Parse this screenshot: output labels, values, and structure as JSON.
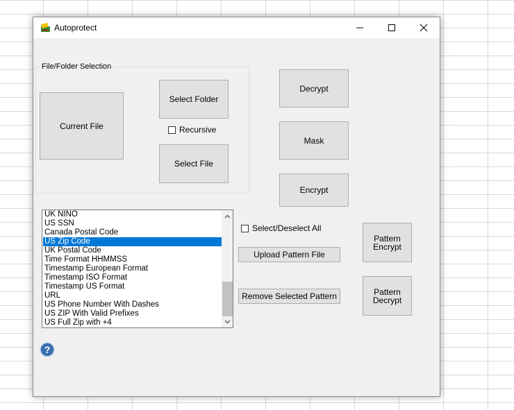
{
  "window": {
    "title": "Autoprotect"
  },
  "file_folder": {
    "group_label": "File/Folder Selection",
    "current_file": "Current File",
    "select_folder": "Select Folder",
    "recursive_label": "Recursive",
    "recursive_checked": false,
    "select_file": "Select File"
  },
  "actions": {
    "decrypt": "Decrypt",
    "mask": "Mask",
    "encrypt": "Encrypt"
  },
  "patterns": {
    "items": [
      "UK NINO",
      "US SSN",
      "Canada Postal Code",
      "US Zip Code",
      "UK Postal Code",
      "Time Format HHMMSS",
      "Timestamp European Format",
      "Timestamp ISO Format",
      "Timestamp US Format",
      "URL",
      "US Phone Number With Dashes",
      "US ZIP With Valid Prefixes",
      "US Full Zip with +4"
    ],
    "selected": "US Zip Code",
    "select_all_label": "Select/Deselect All",
    "select_all_checked": false,
    "upload": "Upload Pattern File",
    "remove": "Remove Selected Pattern",
    "pattern_encrypt": "Pattern Encrypt",
    "pattern_decrypt": "Pattern Decrypt"
  },
  "icons": {
    "app": "app-logo-icon",
    "minimize": "minimize-icon",
    "maximize": "maximize-icon",
    "close": "close-icon",
    "help": "help-icon",
    "scroll_up": "chevron-up-icon",
    "scroll_down": "chevron-down-icon"
  },
  "colors": {
    "selection": "#0078d7",
    "button_face": "#e1e1e1",
    "window_bg": "#f0f0f0",
    "help_blue": "#3a6fb0"
  }
}
